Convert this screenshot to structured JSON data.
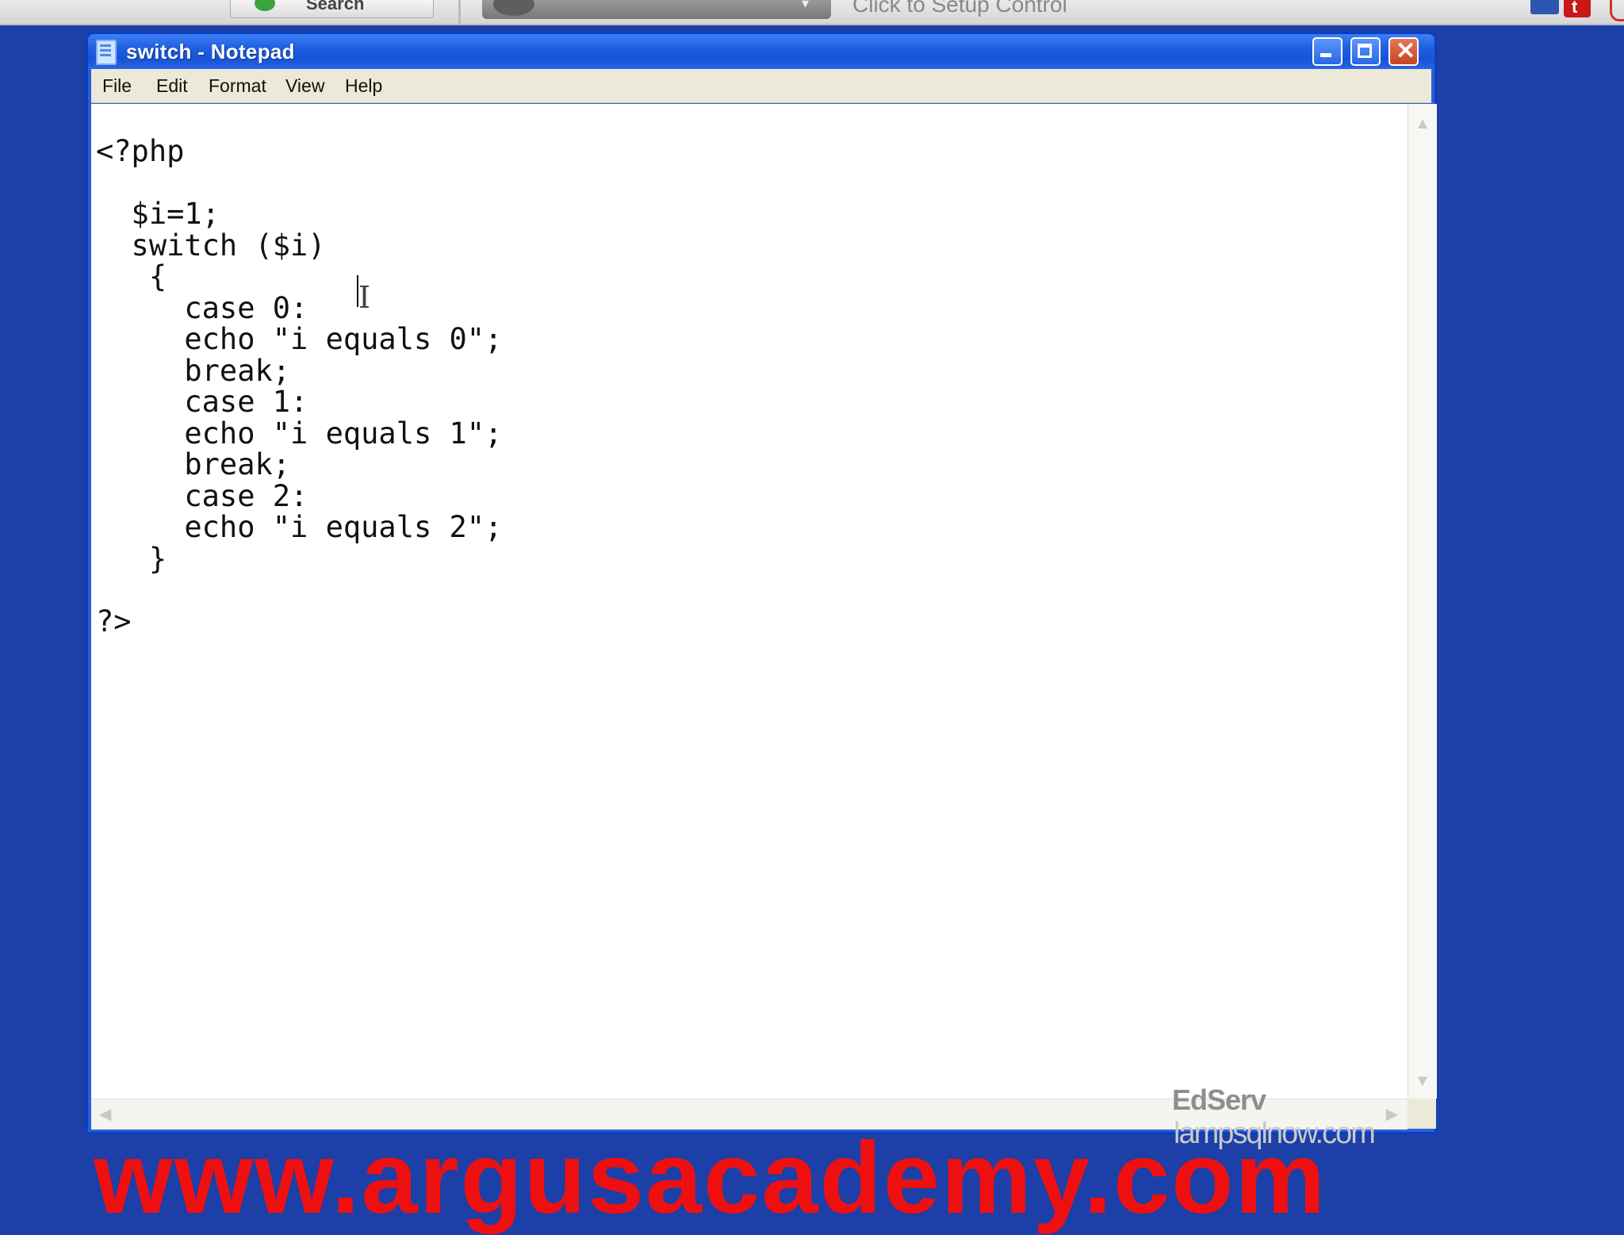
{
  "browser_toolbar": {
    "search_label": "Search",
    "dropdown_glyph": "▾",
    "setup_hint": "Click to Setup Control",
    "youtube_icon_glyph": "t"
  },
  "window": {
    "title": "switch - Notepad",
    "close_glyph": "✕"
  },
  "menu": {
    "file": "File",
    "edit": "Edit",
    "format": "Format",
    "view": "View",
    "help": "Help"
  },
  "editor": {
    "content": "<?php\n\n  $i=1;\n  switch ($i)\n   {\n     case 0:\n     echo \"i equals 0\";\n     break;\n     case 1:\n     echo \"i equals 1\";\n     break;\n     case 2:\n     echo \"i equals 2\";\n   }\n\n?>"
  },
  "scrollbars": {
    "up": "▲",
    "down": "▼",
    "left": "◀",
    "right": "▶"
  },
  "watermarks": {
    "edserv": "EdServ",
    "lamp_url": "lampsqlnow.com",
    "argus": "www.argusacademy.com"
  }
}
